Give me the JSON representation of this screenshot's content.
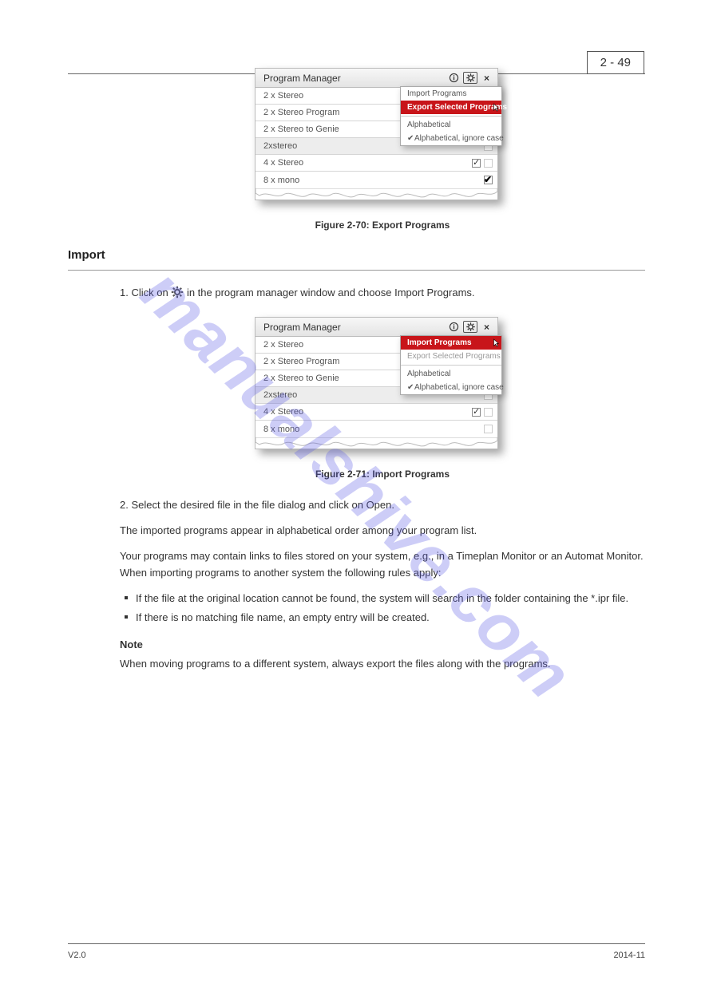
{
  "page_badge": "2 - 49",
  "watermark": "manualshive.com",
  "footer": {
    "left": "V2.0",
    "right": "2014-11"
  },
  "fig1": {
    "window_title": "Program Manager",
    "rows": [
      {
        "label": "2 x Stereo",
        "alt": false,
        "check1": "none",
        "check2": "empty"
      },
      {
        "label": "2 x Stereo Program",
        "alt": false,
        "check1": "none",
        "check2": "empty"
      },
      {
        "label": "2 x Stereo to Genie",
        "alt": false,
        "check1": "none",
        "check2": "empty"
      },
      {
        "label": "2xstereo",
        "alt": true,
        "check1": "none",
        "check2": "empty"
      },
      {
        "label": "4 x Stereo",
        "alt": false,
        "check1": "checked",
        "check2": "empty"
      },
      {
        "label": "8 x mono",
        "alt": false,
        "check1": "none",
        "check2": "bold"
      }
    ],
    "dd": {
      "import": "Import Programs",
      "export": "Export Selected Programs",
      "alpha": "Alphabetical",
      "alpha_ic": "Alphabetical, ignore case",
      "selected": "export"
    },
    "caption": "Figure 2-70: Export Programs"
  },
  "section_title": "Import",
  "body": {
    "p1_before": "1. Click on ",
    "p1_after": " in the program manager window and choose Import Programs.",
    "p2": "2. Select the desired file in the file dialog and click on Open.",
    "p3": "The imported programs appear in alphabetical order among your program list.",
    "p4": "Your programs may contain links to files stored on your system, e.g., in a Timeplan Monitor or an Automat Monitor. When importing programs to another system the following rules apply:",
    "li1": "If the file at the original location cannot be found, the system will search in the folder containing the *.ipr file.",
    "li2": "If there is no matching file name, an empty entry will be created.",
    "note_head": "Note",
    "note_body": "When moving programs to a different system, always export the files along with the programs."
  },
  "fig2": {
    "window_title": "Program Manager",
    "rows": [
      {
        "label": "2 x Stereo",
        "alt": false,
        "check1": "none",
        "check2": "empty"
      },
      {
        "label": "2 x Stereo Program",
        "alt": false,
        "check1": "none",
        "check2": "empty"
      },
      {
        "label": "2 x Stereo to Genie",
        "alt": false,
        "check1": "none",
        "check2": "empty"
      },
      {
        "label": "2xstereo",
        "alt": true,
        "check1": "none",
        "check2": "empty"
      },
      {
        "label": "4 x Stereo",
        "alt": false,
        "check1": "checked",
        "check2": "empty"
      },
      {
        "label": "8 x mono",
        "alt": false,
        "check1": "none",
        "check2": "empty"
      }
    ],
    "dd": {
      "import": "Import Programs",
      "export": "Export Selected Programs",
      "alpha": "Alphabetical",
      "alpha_ic": "Alphabetical, ignore case",
      "selected": "import"
    },
    "caption": "Figure 2-71: Import Programs"
  }
}
